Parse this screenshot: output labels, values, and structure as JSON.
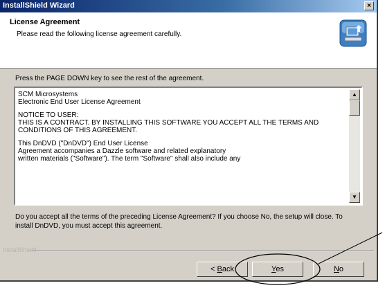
{
  "window": {
    "title": "InstallShield Wizard",
    "close_glyph": "×"
  },
  "header": {
    "title": "License Agreement",
    "subtitle": "Please read the following license agreement carefully.",
    "icon": "installer-computer-icon"
  },
  "instruction": "Press the PAGE DOWN key to see the rest of the agreement.",
  "license": {
    "paragraphs": [
      "SCM Microsystems\nElectronic End User License Agreement",
      "NOTICE TO USER:\nTHIS IS A CONTRACT.  BY INSTALLING THIS SOFTWARE YOU ACCEPT ALL THE TERMS AND CONDITIONS OF THIS AGREEMENT.",
      "This DnDVD (\"DnDVD\") End User License\nAgreement accompanies a Dazzle software and related explanatory\nwritten materials  (\"Software\").  The term \"Software\" shall also include any"
    ],
    "scroll_up_glyph": "▲",
    "scroll_down_glyph": "▼"
  },
  "question": "Do you accept all the terms of the preceding License Agreement?  If you choose No,  the setup will close.  To install DnDVD, you must accept this agreement.",
  "brand": "InstallShield",
  "buttons": {
    "back_prefix": "< ",
    "back_key": "B",
    "back_rest": "ack",
    "yes_key": "Y",
    "yes_rest": "es",
    "no_key": "N",
    "no_rest": "o"
  },
  "colors": {
    "dialog": "#d4d0c8",
    "titlebar_start": "#0a246a",
    "annotation": "#000000"
  }
}
